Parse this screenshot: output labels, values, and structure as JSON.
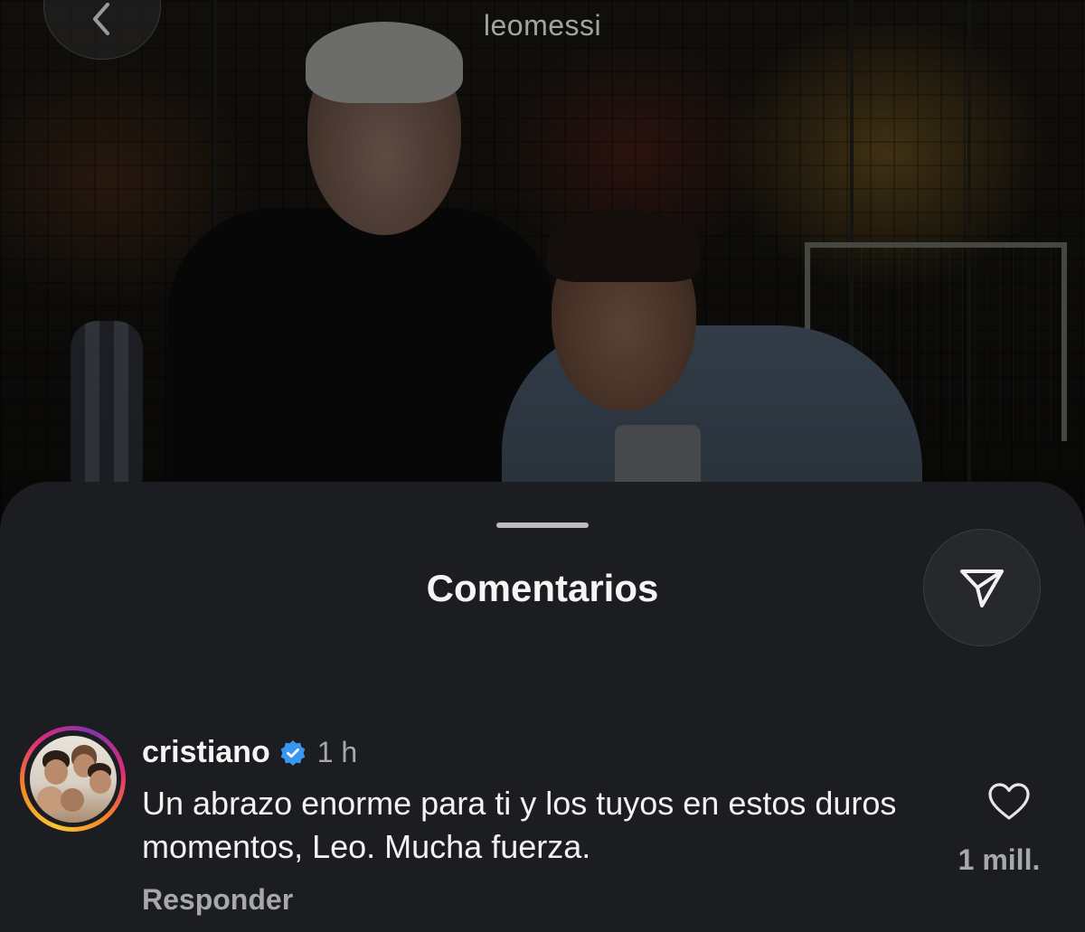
{
  "header": {
    "username": "leomessi"
  },
  "sheet": {
    "title": "Comentarios"
  },
  "comment": {
    "username": "cristiano",
    "verified": true,
    "time": "1 h",
    "text": "Un abrazo enorme para ti y los tuyos en estos duros momentos, Leo. Mucha fuerza.",
    "reply_label": "Responder",
    "like_count": "1 mill."
  },
  "colors": {
    "sheet_bg": "#1c1d20",
    "verified": "#3897f0",
    "muted_text": "#a7a8ab"
  },
  "icons": {
    "back": "chevron-left-icon",
    "share": "paper-plane-icon",
    "verified": "verified-badge-icon",
    "like": "heart-outline-icon"
  }
}
